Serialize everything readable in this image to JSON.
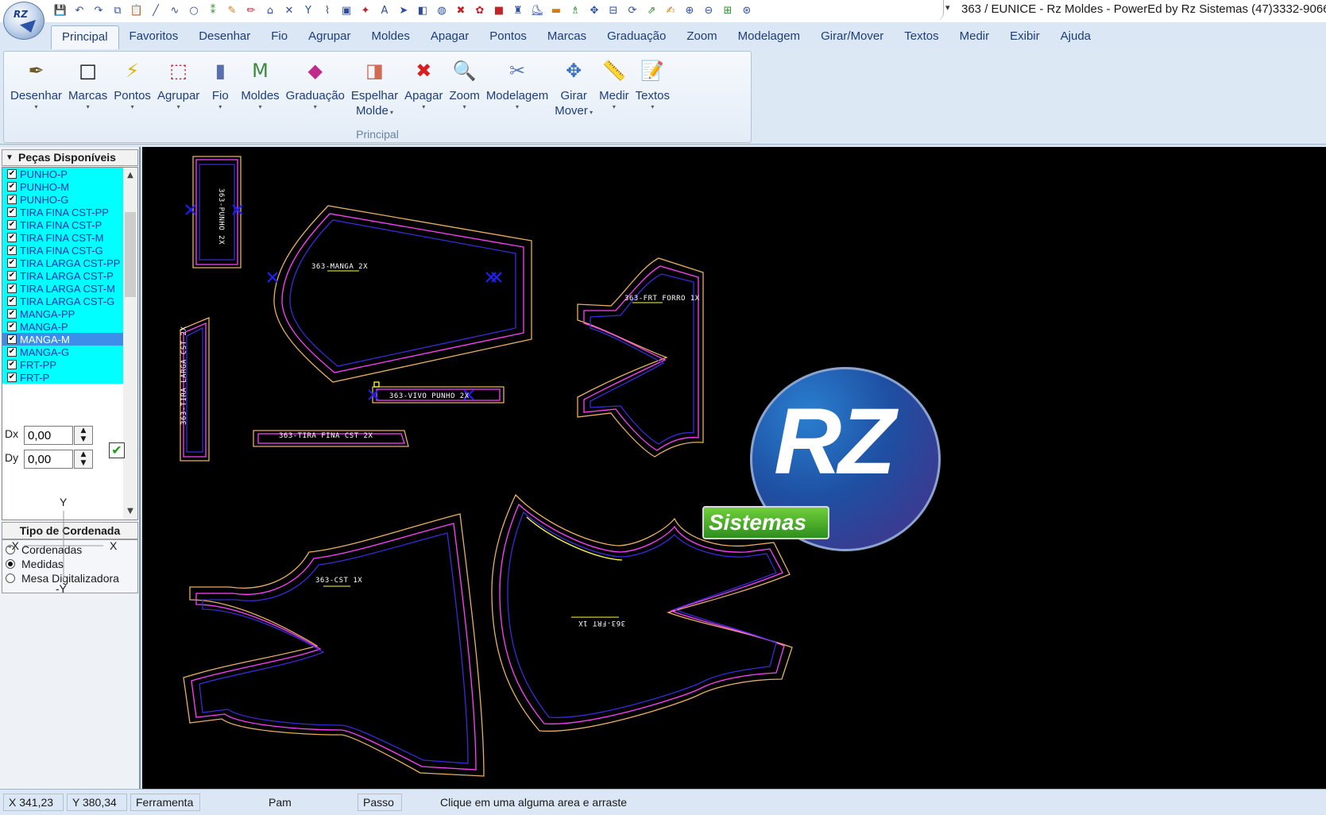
{
  "window": {
    "title": "363 / EUNICE - Rz Moldes - PowerEd by Rz Sistemas (47)3332-9066",
    "app_orb_text": "RZ"
  },
  "quick_access": [
    {
      "icon": "save-icon",
      "glyph": "💾",
      "tone": ""
    },
    {
      "icon": "undo-icon",
      "glyph": "↶",
      "tone": ""
    },
    {
      "icon": "redo-icon",
      "glyph": "↷",
      "tone": ""
    },
    {
      "icon": "copy-icon",
      "glyph": "⧉",
      "tone": ""
    },
    {
      "icon": "paste-icon",
      "glyph": "📋",
      "tone": ""
    },
    {
      "icon": "line-icon",
      "glyph": "╱",
      "tone": ""
    },
    {
      "icon": "curve-icon",
      "glyph": "∿",
      "tone": ""
    },
    {
      "icon": "circle-icon",
      "glyph": "○",
      "tone": ""
    },
    {
      "icon": "point-icon",
      "glyph": "⁑",
      "tone": "g"
    },
    {
      "icon": "pen-icon",
      "glyph": "✎",
      "tone": "o"
    },
    {
      "icon": "pencil-icon",
      "glyph": "✏",
      "tone": "r"
    },
    {
      "icon": "ruler-icon",
      "glyph": "⌂",
      "tone": ""
    },
    {
      "icon": "cross-mark-icon",
      "glyph": "✕",
      "tone": ""
    },
    {
      "icon": "y-mark-icon",
      "glyph": "Y",
      "tone": ""
    },
    {
      "icon": "split-icon",
      "glyph": "⌇",
      "tone": ""
    },
    {
      "icon": "piece-icon",
      "glyph": "▣",
      "tone": ""
    },
    {
      "icon": "star-icon",
      "glyph": "✦",
      "tone": "r"
    },
    {
      "icon": "text-a-icon",
      "glyph": "A",
      "tone": ""
    },
    {
      "icon": "arrow-icon",
      "glyph": "➤",
      "tone": ""
    },
    {
      "icon": "mirror-icon",
      "glyph": "◧",
      "tone": ""
    },
    {
      "icon": "node-icon",
      "glyph": "◍",
      "tone": ""
    },
    {
      "icon": "delete-mark-icon",
      "glyph": "✖",
      "tone": "r"
    },
    {
      "icon": "gear-icon",
      "glyph": "✿",
      "tone": "r"
    },
    {
      "icon": "cube-icon",
      "glyph": "■",
      "tone": "r"
    },
    {
      "icon": "shirt-icon",
      "glyph": "♜",
      "tone": ""
    },
    {
      "icon": "shoe-icon",
      "glyph": "⛸",
      "tone": ""
    },
    {
      "icon": "measure-icon",
      "glyph": "▬",
      "tone": "o"
    },
    {
      "icon": "bottle-icon",
      "glyph": "♗",
      "tone": "g"
    },
    {
      "icon": "move-icon",
      "glyph": "✥",
      "tone": ""
    },
    {
      "icon": "layer-icon",
      "glyph": "⊟",
      "tone": ""
    },
    {
      "icon": "rotate-icon",
      "glyph": "⟳",
      "tone": ""
    },
    {
      "icon": "export-icon",
      "glyph": "⇗",
      "tone": "g"
    },
    {
      "icon": "edit-text-icon",
      "glyph": "✍",
      "tone": "o"
    },
    {
      "icon": "zoom-in-icon",
      "glyph": "⊕",
      "tone": ""
    },
    {
      "icon": "zoom-out-icon",
      "glyph": "⊖",
      "tone": ""
    },
    {
      "icon": "zoom-window-icon",
      "glyph": "⊞",
      "tone": "g"
    },
    {
      "icon": "zoom-all-icon",
      "glyph": "⊛",
      "tone": ""
    }
  ],
  "tabs": [
    "Principal",
    "Favoritos",
    "Desenhar",
    "Fio",
    "Agrupar",
    "Moldes",
    "Apagar",
    "Pontos",
    "Marcas",
    "Graduação",
    "Zoom",
    "Modelagem",
    "Girar/Mover",
    "Textos",
    "Medir",
    "Exibir",
    "Ajuda"
  ],
  "ribbon": {
    "group_label": "Principal",
    "buttons": [
      {
        "line1": "Desenhar",
        "line2": "",
        "icon": "draw-pen-icon",
        "glyph": "✒",
        "color": "#6b5a2a"
      },
      {
        "line1": "Marcas",
        "line2": "",
        "icon": "marks-square-icon",
        "glyph": "□",
        "color": "#111111"
      },
      {
        "line1": "Pontos",
        "line2": "",
        "icon": "points-wand-icon",
        "glyph": "⚡",
        "color": "#d9b400"
      },
      {
        "line1": "Agrupar",
        "line2": "",
        "icon": "group-dashed-icon",
        "glyph": "⬚",
        "color": "#d02020"
      },
      {
        "line1": "Fio",
        "line2": "",
        "icon": "grain-line-icon",
        "glyph": "▮",
        "color": "#5a6fb0"
      },
      {
        "line1": "Moldes",
        "line2": "",
        "icon": "pattern-m-icon",
        "glyph": "M",
        "color": "#3d8a3d"
      },
      {
        "line1": "Graduação",
        "line2": "",
        "icon": "grading-icon",
        "glyph": "◆",
        "color": "#c02a8a"
      },
      {
        "line1": "Espelhar",
        "line2": "Molde",
        "icon": "mirror-pattern-icon",
        "glyph": "◨",
        "color": "#d06a50"
      },
      {
        "line1": "Apagar",
        "line2": "",
        "icon": "delete-x-icon",
        "glyph": "✖",
        "color": "#d81e1e"
      },
      {
        "line1": "Zoom",
        "line2": "",
        "icon": "zoom-magnifier-icon",
        "glyph": "🔍",
        "color": "#2a5ba8"
      },
      {
        "line1": "Modelagem",
        "line2": "",
        "icon": "modeling-icon",
        "glyph": "✂",
        "color": "#5a78b8"
      },
      {
        "line1": "Girar",
        "line2": "Mover",
        "icon": "rotate-move-icon",
        "glyph": "✥",
        "color": "#3a72c0"
      },
      {
        "line1": "Medir",
        "line2": "",
        "icon": "ruler-measure-icon",
        "glyph": "📏",
        "color": "#d8a020"
      },
      {
        "line1": "Textos",
        "line2": "",
        "icon": "notepad-text-icon",
        "glyph": "📝",
        "color": "#d08030"
      }
    ]
  },
  "pieces_panel": {
    "title": "Peças Disponíveis",
    "items": [
      {
        "name": "PUNHO-P",
        "checked": true,
        "selected": false
      },
      {
        "name": "PUNHO-M",
        "checked": true,
        "selected": false
      },
      {
        "name": "PUNHO-G",
        "checked": true,
        "selected": false
      },
      {
        "name": "TIRA FINA CST-PP",
        "checked": true,
        "selected": false
      },
      {
        "name": "TIRA FINA CST-P",
        "checked": true,
        "selected": false
      },
      {
        "name": "TIRA FINA CST-M",
        "checked": true,
        "selected": false
      },
      {
        "name": "TIRA FINA CST-G",
        "checked": true,
        "selected": false
      },
      {
        "name": "TIRA LARGA CST-PP",
        "checked": true,
        "selected": false
      },
      {
        "name": "TIRA LARGA CST-P",
        "checked": true,
        "selected": false
      },
      {
        "name": "TIRA LARGA CST-M",
        "checked": true,
        "selected": false
      },
      {
        "name": "TIRA LARGA CST-G",
        "checked": true,
        "selected": false
      },
      {
        "name": "MANGA-PP",
        "checked": true,
        "selected": false
      },
      {
        "name": "MANGA-P",
        "checked": true,
        "selected": false
      },
      {
        "name": "MANGA-M",
        "checked": true,
        "selected": true
      },
      {
        "name": "MANGA-G",
        "checked": true,
        "selected": false
      },
      {
        "name": "FRT-PP",
        "checked": true,
        "selected": false
      },
      {
        "name": "FRT-P",
        "checked": true,
        "selected": false
      }
    ]
  },
  "coord_panel": {
    "title": "Tipo de Cordenada",
    "options": [
      {
        "label": "Cordenadas",
        "checked": false
      },
      {
        "label": "Medidas",
        "checked": true
      },
      {
        "label": "Mesa Digitalizadora",
        "checked": false
      }
    ],
    "dx_label": "Dx",
    "dy_label": "Dy",
    "dx_value": "0,00",
    "dy_value": "0,00",
    "axis": {
      "y": "Y",
      "neg_y": "-Y",
      "x": "X",
      "neg_x": "-X"
    }
  },
  "canvas": {
    "piece_labels": [
      "363-PUNHO 2X",
      "363-MANGA 2X",
      "363-FRT FORRO 1X",
      "363-TIRA LARGA CST 2X",
      "363-VIVO PUNHO 2X",
      "363-TIRA FINA CST 2X",
      "363-CST 1X",
      "363-FRT 1X"
    ],
    "logo": {
      "main": "RZ",
      "sub": "Sistemas"
    },
    "colors": {
      "outer": "#e8b060",
      "inner": "#ff40ff",
      "mid": "#3a2ad8",
      "cut": "#ffff40",
      "marker": "#2020ff"
    }
  },
  "statusbar": {
    "x": "X 341,23",
    "y": "Y 380,34",
    "tool_label": "Ferramenta",
    "tool_value": "Pam",
    "step_label": "Passo",
    "hint": "Clique em uma alguma area e arraste"
  }
}
